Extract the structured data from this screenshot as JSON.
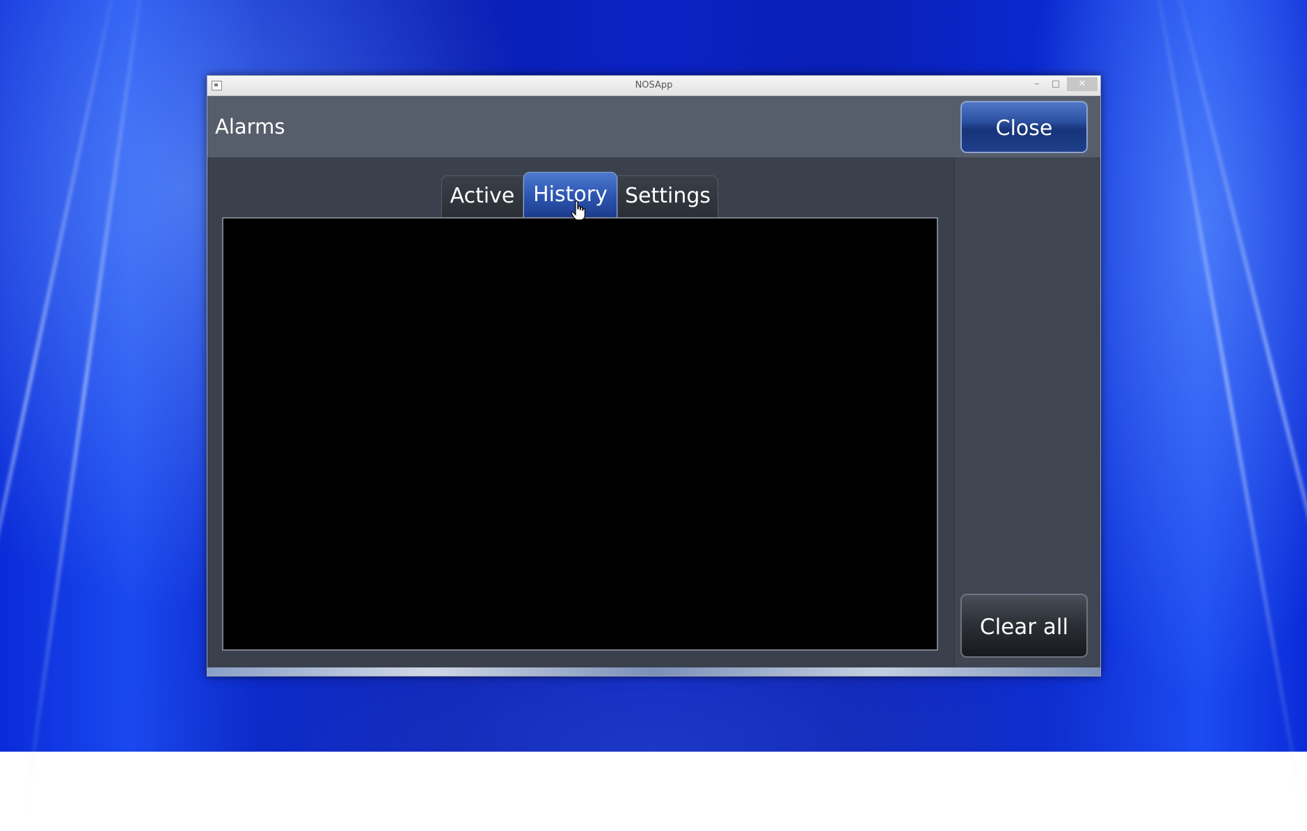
{
  "window": {
    "title": "NOSApp",
    "controls": {
      "minimize": "–",
      "maximize": "□",
      "close": "✕"
    }
  },
  "header": {
    "title": "Alarms",
    "close_label": "Close"
  },
  "tabs": [
    {
      "label": "Active",
      "selected": false
    },
    {
      "label": "History",
      "selected": true
    },
    {
      "label": "Settings",
      "selected": false
    }
  ],
  "actions": {
    "clear_all_label": "Clear all"
  },
  "colors": {
    "selected_tab": "#2e57b2",
    "close_button": "#2b4f9f",
    "panel_background": "#3b414c",
    "list_background": "#000000"
  }
}
